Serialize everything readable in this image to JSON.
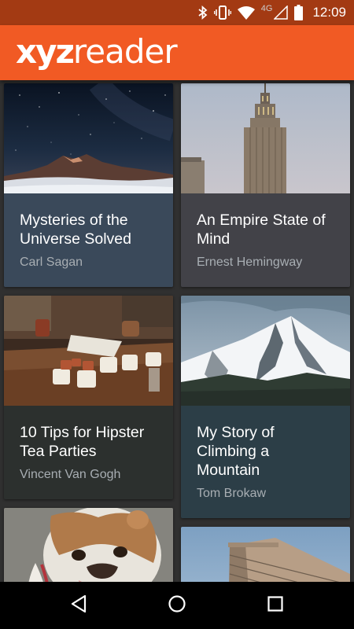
{
  "status_bar": {
    "time": "12:09",
    "network": "4G",
    "icons": [
      "bluetooth-icon",
      "vibrate-icon",
      "wifi-icon",
      "signal-icon",
      "battery-icon"
    ]
  },
  "app_bar": {
    "logo_bold": "xyz",
    "logo_regular": "reader",
    "color": "#f15a24"
  },
  "articles": [
    {
      "title": "Mysteries of the Universe Solved",
      "author": "Carl Sagan",
      "card_color": "#3a495a"
    },
    {
      "title": "An Empire State of Mind",
      "author": "Ernest Hemingway",
      "card_color": "#424248"
    },
    {
      "title": "10 Tips for Hipster Tea Parties",
      "author": "Vincent Van Gogh",
      "card_color": "#2c302e"
    },
    {
      "title": "My Story of Climbing a Mountain",
      "author": "Tom Brokaw",
      "card_color": "#2c3e47"
    },
    {
      "title": "",
      "author": "",
      "card_color": "#3a3a3a"
    },
    {
      "title": "",
      "author": "",
      "card_color": "#3a3a3a"
    }
  ],
  "nav_bar": {
    "buttons": [
      "back-icon",
      "home-icon",
      "recents-icon"
    ]
  }
}
